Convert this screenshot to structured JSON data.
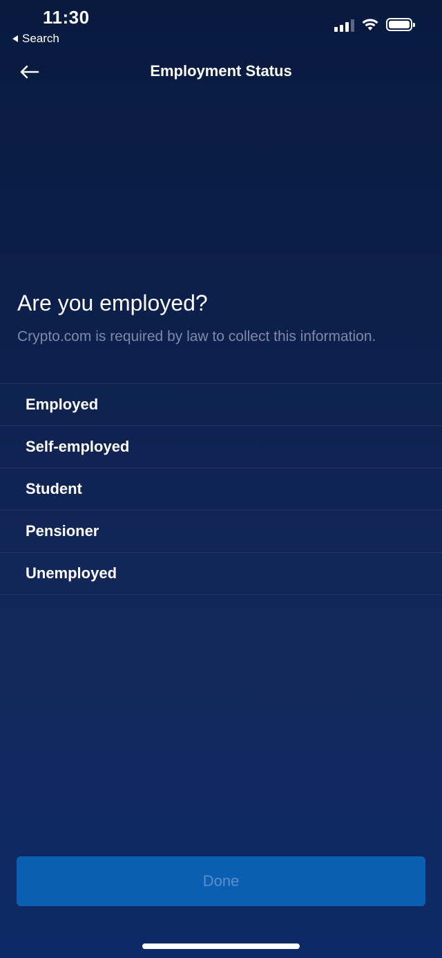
{
  "status_bar": {
    "time": "11:30",
    "back_app_label": "Search",
    "signal_bars_filled": 3,
    "signal_bars_total": 4
  },
  "nav": {
    "title": "Employment Status",
    "back_icon": "arrow-left-icon"
  },
  "content": {
    "question": "Are you employed?",
    "subtitle": "Crypto.com is required by law to collect this information."
  },
  "options": [
    {
      "label": "Employed"
    },
    {
      "label": "Self-employed"
    },
    {
      "label": "Student"
    },
    {
      "label": "Pensioner"
    },
    {
      "label": "Unemployed"
    }
  ],
  "footer": {
    "done_label": "Done"
  },
  "colors": {
    "background": "#0c1f4a",
    "button": "#0b5fb3",
    "button_text_disabled": "#5c8fc9",
    "divider": "#1f3566",
    "subtitle": "#7d8aa8"
  }
}
